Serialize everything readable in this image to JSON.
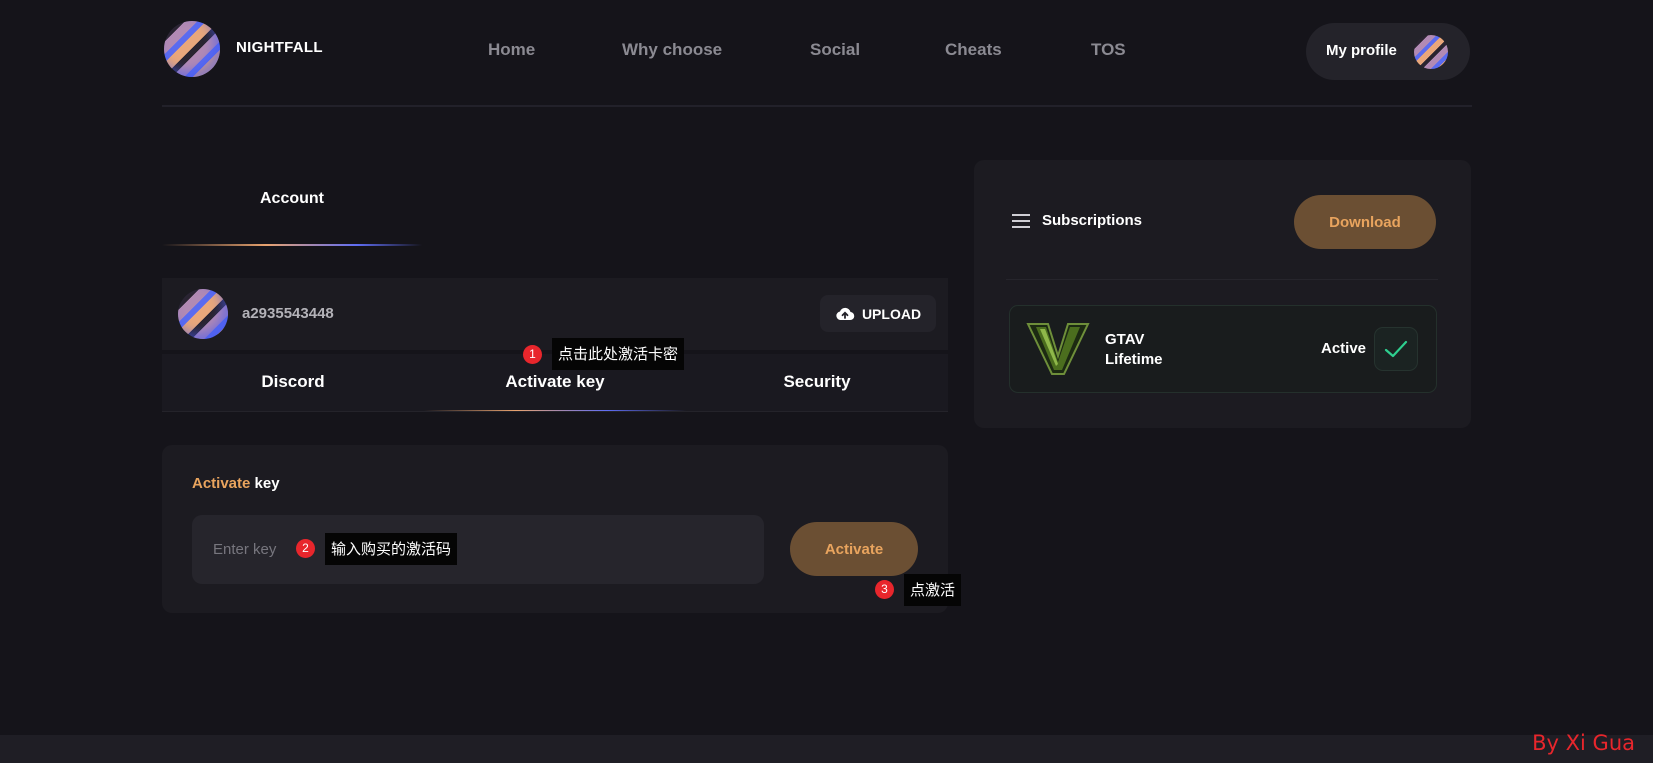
{
  "header": {
    "brand": "NIGHTFALL",
    "nav": [
      "Home",
      "Why choose",
      "Social",
      "Cheats",
      "TOS"
    ],
    "profile_label": "My profile"
  },
  "account": {
    "tab_label": "Account",
    "username": "a2935543448",
    "upload_label": "UPLOAD",
    "subtabs": [
      "Discord",
      "Activate key",
      "Security"
    ],
    "active_subtab": "Activate key"
  },
  "activate_card": {
    "title_accent": "Activate",
    "title_rest": " key",
    "input_placeholder": "Enter key",
    "input_value": "",
    "button_label": "Activate"
  },
  "annotations": [
    {
      "num": "1",
      "text": "点击此处激活卡密"
    },
    {
      "num": "2",
      "text": "输入购买的激活码"
    },
    {
      "num": "3",
      "text": "点激活"
    }
  ],
  "subscriptions": {
    "title": "Subscriptions",
    "download_label": "Download",
    "items": [
      {
        "name": "GTAV",
        "duration": "Lifetime",
        "status": "Active",
        "icon": "gta-v-logo"
      }
    ]
  },
  "watermark": "By Xi Gua",
  "colors": {
    "background": "#15141a",
    "panel": "#1c1b21",
    "accent_orange": "#e9a45e",
    "button_brown": "#6b4f33",
    "active_green": "#2ecf8f",
    "annotation_red": "#e8262c"
  }
}
